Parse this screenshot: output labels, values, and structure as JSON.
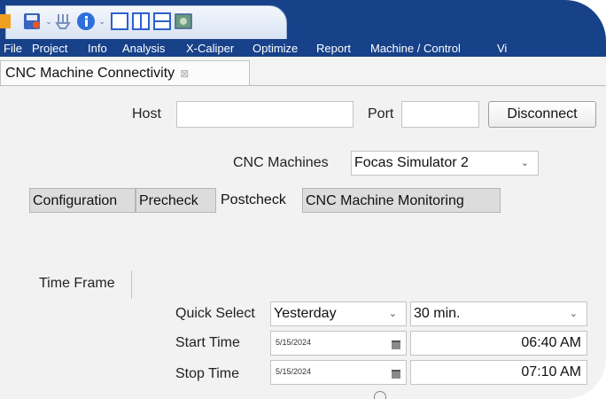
{
  "menu": {
    "items": [
      "File",
      "Project",
      "Info",
      "Analysis",
      "X-Caliper",
      "Optimize",
      "Report",
      "Machine / Control",
      "Vi"
    ]
  },
  "tab": {
    "title": "CNC Machine Connectivity",
    "close": "⊠"
  },
  "connection": {
    "host_label": "Host",
    "host_value": "",
    "port_label": "Port",
    "port_value": "",
    "disconnect_label": "Disconnect"
  },
  "machines": {
    "label": "CNC Machines",
    "selected": "Focas Simulator 2"
  },
  "subtabs": [
    "Configuration",
    "Precheck",
    "Postcheck",
    "CNC Machine Monitoring"
  ],
  "active_subtab": "Postcheck",
  "time_frame": {
    "label": "Time Frame",
    "quick_select_label": "Quick Select",
    "quick_select_value": "Yesterday",
    "interval_value": "30 min.",
    "start_label": "Start Time",
    "start_date": "5/15/2024",
    "start_time": "06:40 AM",
    "stop_label": "Stop Time",
    "stop_date": "5/15/2024",
    "stop_time": "07:10 AM"
  },
  "colors": {
    "menubar": "#17428a",
    "accent": "#3a7bd5"
  }
}
